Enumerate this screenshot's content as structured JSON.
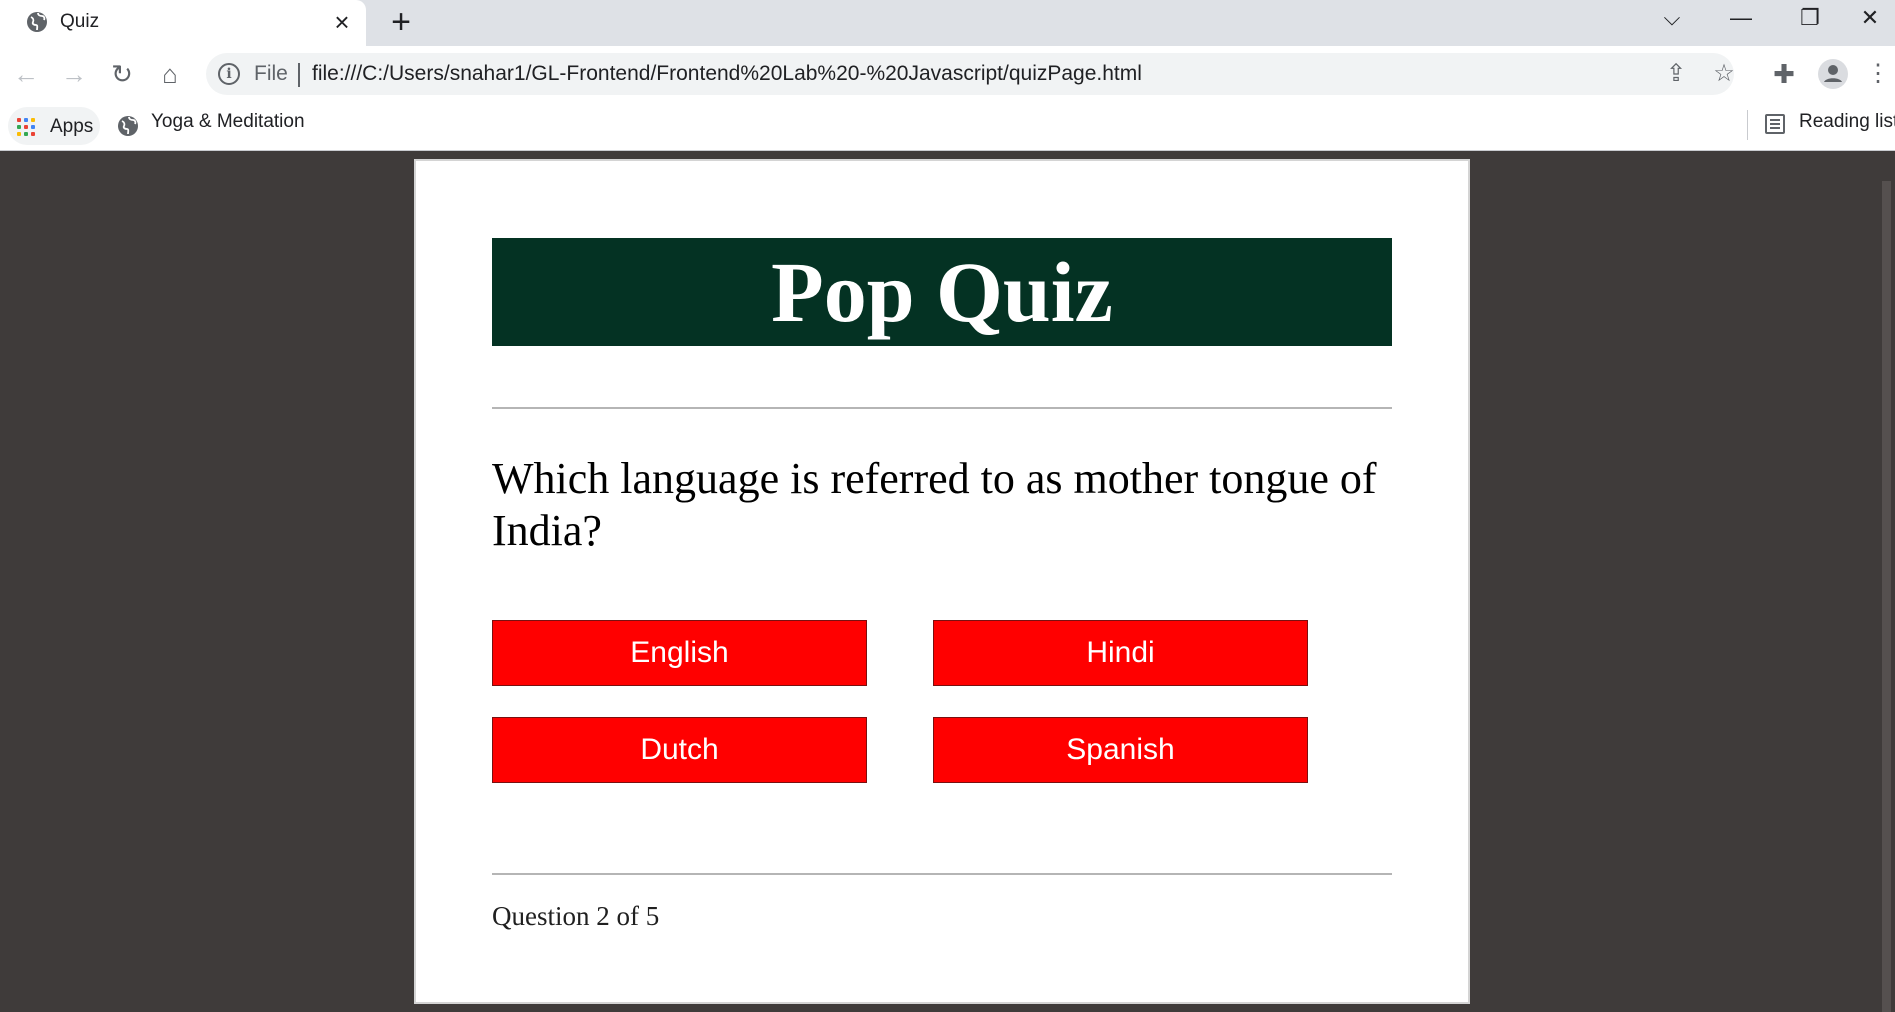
{
  "browser": {
    "tab_title": "Quiz",
    "new_tab_symbol": "+",
    "address_scheme": "File",
    "url": "file:///C:/Users/snahar1/GL-Frontend/Frontend%20Lab%20-%20Javascript/quizPage.html",
    "bookmarks": [
      {
        "label": "Apps",
        "icon": "apps-grid-icon"
      },
      {
        "label": "Yoga & Meditation",
        "icon": "globe-icon"
      }
    ],
    "reading_list_label": "Reading list"
  },
  "quiz": {
    "title": "Pop Quiz",
    "question": "Which language is referred to as mother tongue of India?",
    "answers": [
      "English",
      "Hindi",
      "Dutch",
      "Spanish"
    ],
    "progress": "Question 2 of 5"
  },
  "colors": {
    "header_bg": "#043223",
    "answer_bg": "#ff0000",
    "page_bg": "#3f3b3a"
  }
}
